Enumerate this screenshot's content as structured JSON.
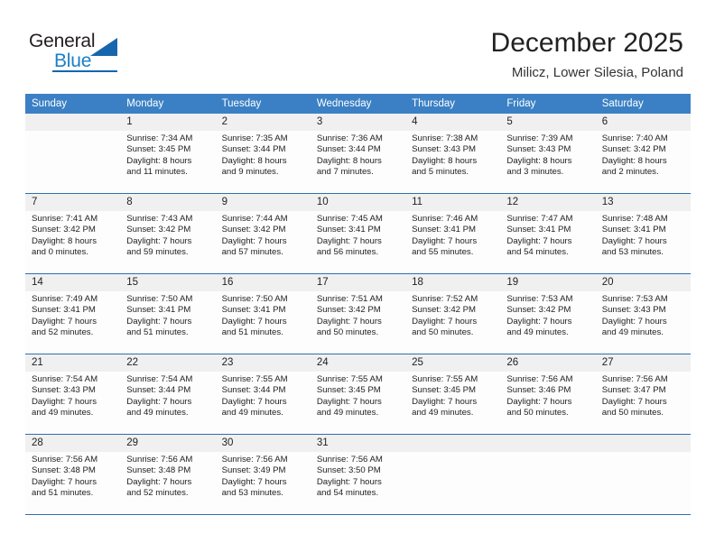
{
  "logo": {
    "general_text": "General",
    "blue_text": "Blue",
    "triangle_icon": "triangle-icon",
    "brand_color": "#1566ad",
    "accent_color": "#1c7fc4"
  },
  "header": {
    "month_title": "December 2025",
    "location": "Milicz, Lower Silesia, Poland"
  },
  "calendar": {
    "header_color": "#3b80c4",
    "daynum_band_color": "#f0f0f0",
    "weekdays": [
      "Sunday",
      "Monday",
      "Tuesday",
      "Wednesday",
      "Thursday",
      "Friday",
      "Saturday"
    ],
    "weeks": [
      [
        {
          "day": "",
          "lines": []
        },
        {
          "day": "1",
          "lines": [
            "Sunrise: 7:34 AM",
            "Sunset: 3:45 PM",
            "Daylight: 8 hours",
            "and 11 minutes."
          ]
        },
        {
          "day": "2",
          "lines": [
            "Sunrise: 7:35 AM",
            "Sunset: 3:44 PM",
            "Daylight: 8 hours",
            "and 9 minutes."
          ]
        },
        {
          "day": "3",
          "lines": [
            "Sunrise: 7:36 AM",
            "Sunset: 3:44 PM",
            "Daylight: 8 hours",
            "and 7 minutes."
          ]
        },
        {
          "day": "4",
          "lines": [
            "Sunrise: 7:38 AM",
            "Sunset: 3:43 PM",
            "Daylight: 8 hours",
            "and 5 minutes."
          ]
        },
        {
          "day": "5",
          "lines": [
            "Sunrise: 7:39 AM",
            "Sunset: 3:43 PM",
            "Daylight: 8 hours",
            "and 3 minutes."
          ]
        },
        {
          "day": "6",
          "lines": [
            "Sunrise: 7:40 AM",
            "Sunset: 3:42 PM",
            "Daylight: 8 hours",
            "and 2 minutes."
          ]
        }
      ],
      [
        {
          "day": "7",
          "lines": [
            "Sunrise: 7:41 AM",
            "Sunset: 3:42 PM",
            "Daylight: 8 hours",
            "and 0 minutes."
          ]
        },
        {
          "day": "8",
          "lines": [
            "Sunrise: 7:43 AM",
            "Sunset: 3:42 PM",
            "Daylight: 7 hours",
            "and 59 minutes."
          ]
        },
        {
          "day": "9",
          "lines": [
            "Sunrise: 7:44 AM",
            "Sunset: 3:42 PM",
            "Daylight: 7 hours",
            "and 57 minutes."
          ]
        },
        {
          "day": "10",
          "lines": [
            "Sunrise: 7:45 AM",
            "Sunset: 3:41 PM",
            "Daylight: 7 hours",
            "and 56 minutes."
          ]
        },
        {
          "day": "11",
          "lines": [
            "Sunrise: 7:46 AM",
            "Sunset: 3:41 PM",
            "Daylight: 7 hours",
            "and 55 minutes."
          ]
        },
        {
          "day": "12",
          "lines": [
            "Sunrise: 7:47 AM",
            "Sunset: 3:41 PM",
            "Daylight: 7 hours",
            "and 54 minutes."
          ]
        },
        {
          "day": "13",
          "lines": [
            "Sunrise: 7:48 AM",
            "Sunset: 3:41 PM",
            "Daylight: 7 hours",
            "and 53 minutes."
          ]
        }
      ],
      [
        {
          "day": "14",
          "lines": [
            "Sunrise: 7:49 AM",
            "Sunset: 3:41 PM",
            "Daylight: 7 hours",
            "and 52 minutes."
          ]
        },
        {
          "day": "15",
          "lines": [
            "Sunrise: 7:50 AM",
            "Sunset: 3:41 PM",
            "Daylight: 7 hours",
            "and 51 minutes."
          ]
        },
        {
          "day": "16",
          "lines": [
            "Sunrise: 7:50 AM",
            "Sunset: 3:41 PM",
            "Daylight: 7 hours",
            "and 51 minutes."
          ]
        },
        {
          "day": "17",
          "lines": [
            "Sunrise: 7:51 AM",
            "Sunset: 3:42 PM",
            "Daylight: 7 hours",
            "and 50 minutes."
          ]
        },
        {
          "day": "18",
          "lines": [
            "Sunrise: 7:52 AM",
            "Sunset: 3:42 PM",
            "Daylight: 7 hours",
            "and 50 minutes."
          ]
        },
        {
          "day": "19",
          "lines": [
            "Sunrise: 7:53 AM",
            "Sunset: 3:42 PM",
            "Daylight: 7 hours",
            "and 49 minutes."
          ]
        },
        {
          "day": "20",
          "lines": [
            "Sunrise: 7:53 AM",
            "Sunset: 3:43 PM",
            "Daylight: 7 hours",
            "and 49 minutes."
          ]
        }
      ],
      [
        {
          "day": "21",
          "lines": [
            "Sunrise: 7:54 AM",
            "Sunset: 3:43 PM",
            "Daylight: 7 hours",
            "and 49 minutes."
          ]
        },
        {
          "day": "22",
          "lines": [
            "Sunrise: 7:54 AM",
            "Sunset: 3:44 PM",
            "Daylight: 7 hours",
            "and 49 minutes."
          ]
        },
        {
          "day": "23",
          "lines": [
            "Sunrise: 7:55 AM",
            "Sunset: 3:44 PM",
            "Daylight: 7 hours",
            "and 49 minutes."
          ]
        },
        {
          "day": "24",
          "lines": [
            "Sunrise: 7:55 AM",
            "Sunset: 3:45 PM",
            "Daylight: 7 hours",
            "and 49 minutes."
          ]
        },
        {
          "day": "25",
          "lines": [
            "Sunrise: 7:55 AM",
            "Sunset: 3:45 PM",
            "Daylight: 7 hours",
            "and 49 minutes."
          ]
        },
        {
          "day": "26",
          "lines": [
            "Sunrise: 7:56 AM",
            "Sunset: 3:46 PM",
            "Daylight: 7 hours",
            "and 50 minutes."
          ]
        },
        {
          "day": "27",
          "lines": [
            "Sunrise: 7:56 AM",
            "Sunset: 3:47 PM",
            "Daylight: 7 hours",
            "and 50 minutes."
          ]
        }
      ],
      [
        {
          "day": "28",
          "lines": [
            "Sunrise: 7:56 AM",
            "Sunset: 3:48 PM",
            "Daylight: 7 hours",
            "and 51 minutes."
          ]
        },
        {
          "day": "29",
          "lines": [
            "Sunrise: 7:56 AM",
            "Sunset: 3:48 PM",
            "Daylight: 7 hours",
            "and 52 minutes."
          ]
        },
        {
          "day": "30",
          "lines": [
            "Sunrise: 7:56 AM",
            "Sunset: 3:49 PM",
            "Daylight: 7 hours",
            "and 53 minutes."
          ]
        },
        {
          "day": "31",
          "lines": [
            "Sunrise: 7:56 AM",
            "Sunset: 3:50 PM",
            "Daylight: 7 hours",
            "and 54 minutes."
          ]
        },
        {
          "day": "",
          "lines": []
        },
        {
          "day": "",
          "lines": []
        },
        {
          "day": "",
          "lines": []
        }
      ]
    ]
  }
}
